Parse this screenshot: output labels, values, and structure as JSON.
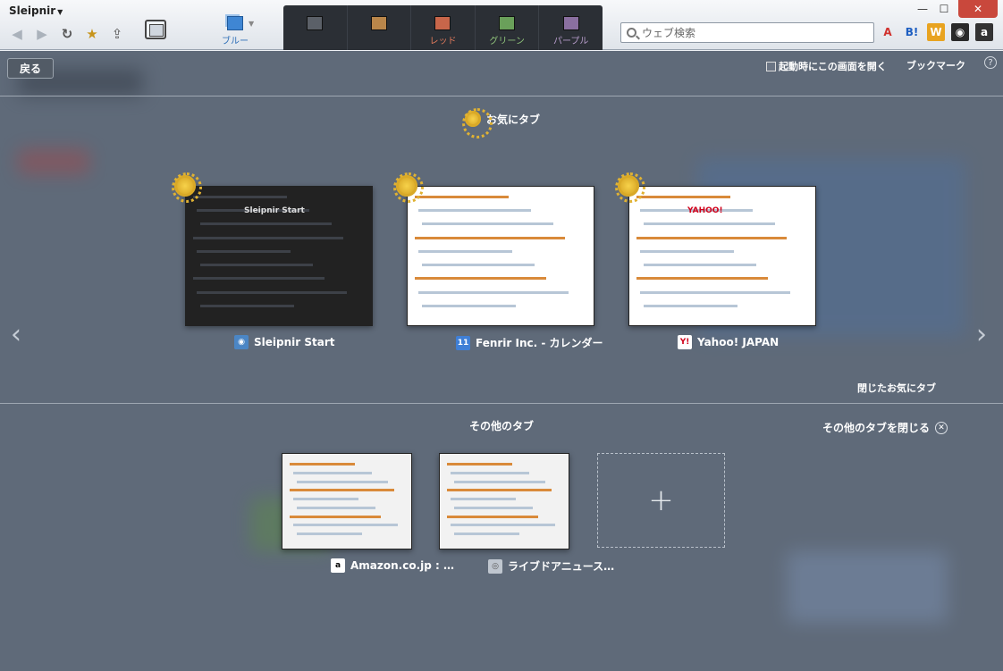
{
  "app": {
    "title": "Sleipnir"
  },
  "toolbar": {
    "back": "◀",
    "forward": "▶",
    "reload": "↻",
    "star": "★",
    "share": "⇪",
    "active_group": {
      "label": "ブルー",
      "color": "#3f86d3"
    },
    "groups": [
      {
        "label": "",
        "color": "#5b6068"
      },
      {
        "label": "",
        "color": "#b9864a"
      },
      {
        "label": "レッド",
        "color": "#c8664a",
        "text_color": "#e07a5c"
      },
      {
        "label": "グリーン",
        "color": "#6aa05a",
        "text_color": "#8fc27a"
      },
      {
        "label": "パープル",
        "color": "#8a6fa0",
        "text_color": "#b59bc9"
      }
    ],
    "search_placeholder": "ウェブ検索",
    "extensions": [
      {
        "label": "A",
        "color": "#d0312d",
        "bg": "transparent"
      },
      {
        "label": "B!",
        "color": "#1d5ec1",
        "bg": "transparent"
      },
      {
        "label": "W",
        "color": "#ffffff",
        "bg": "#e8a320"
      },
      {
        "label": "◉",
        "color": "#ffffff",
        "bg": "#2a2a2a"
      },
      {
        "label": "a",
        "color": "#ffffff",
        "bg": "#333333"
      }
    ],
    "win_min": "—",
    "win_max": "☐",
    "win_close": "✕"
  },
  "overlay": {
    "back_label": "戻る",
    "startup_label": "起動時にこの画面を開く",
    "bookmark_label": "ブックマーク",
    "help": "?",
    "favorite_title": "お気にタブ",
    "closed_favorites": "閉じたお気にタブ",
    "other_title": "その他のタブ",
    "close_others": "その他のタブを閉じる",
    "close_x": "✕",
    "prev": "‹",
    "next": "›",
    "add": "+"
  },
  "favorite_tabs": [
    {
      "title": "Sleipnir Start",
      "icon": "globe-icon",
      "fav_glyph": "◉",
      "fav_bg": "#4b86c5",
      "fav_color": "#ffffff",
      "bg": "#222222",
      "inner_title": "Sleipnir Start"
    },
    {
      "title": "Fenrir Inc. - カレンダー",
      "icon": "calendar-icon",
      "fav_glyph": "11",
      "fav_bg": "#3f7fd6",
      "fav_color": "#ffffff",
      "bg": "#ffffff",
      "inner_title": ""
    },
    {
      "title": "Yahoo! JAPAN",
      "icon": "yahoo-icon",
      "fav_glyph": "Y!",
      "fav_bg": "#ffffff",
      "fav_color": "#d0021b",
      "bg": "#ffffff",
      "inner_title": "YAHOO!"
    }
  ],
  "other_tabs": [
    {
      "title": "Amazon.co.jp : …",
      "icon": "amazon-icon",
      "fav_glyph": "a",
      "fav_bg": "#ffffff",
      "fav_color": "#000000"
    },
    {
      "title": "ライブドアニュース…",
      "icon": "livedoor-icon",
      "fav_glyph": "◎",
      "fav_bg": "#bfc6cf",
      "fav_color": "#555555"
    }
  ]
}
